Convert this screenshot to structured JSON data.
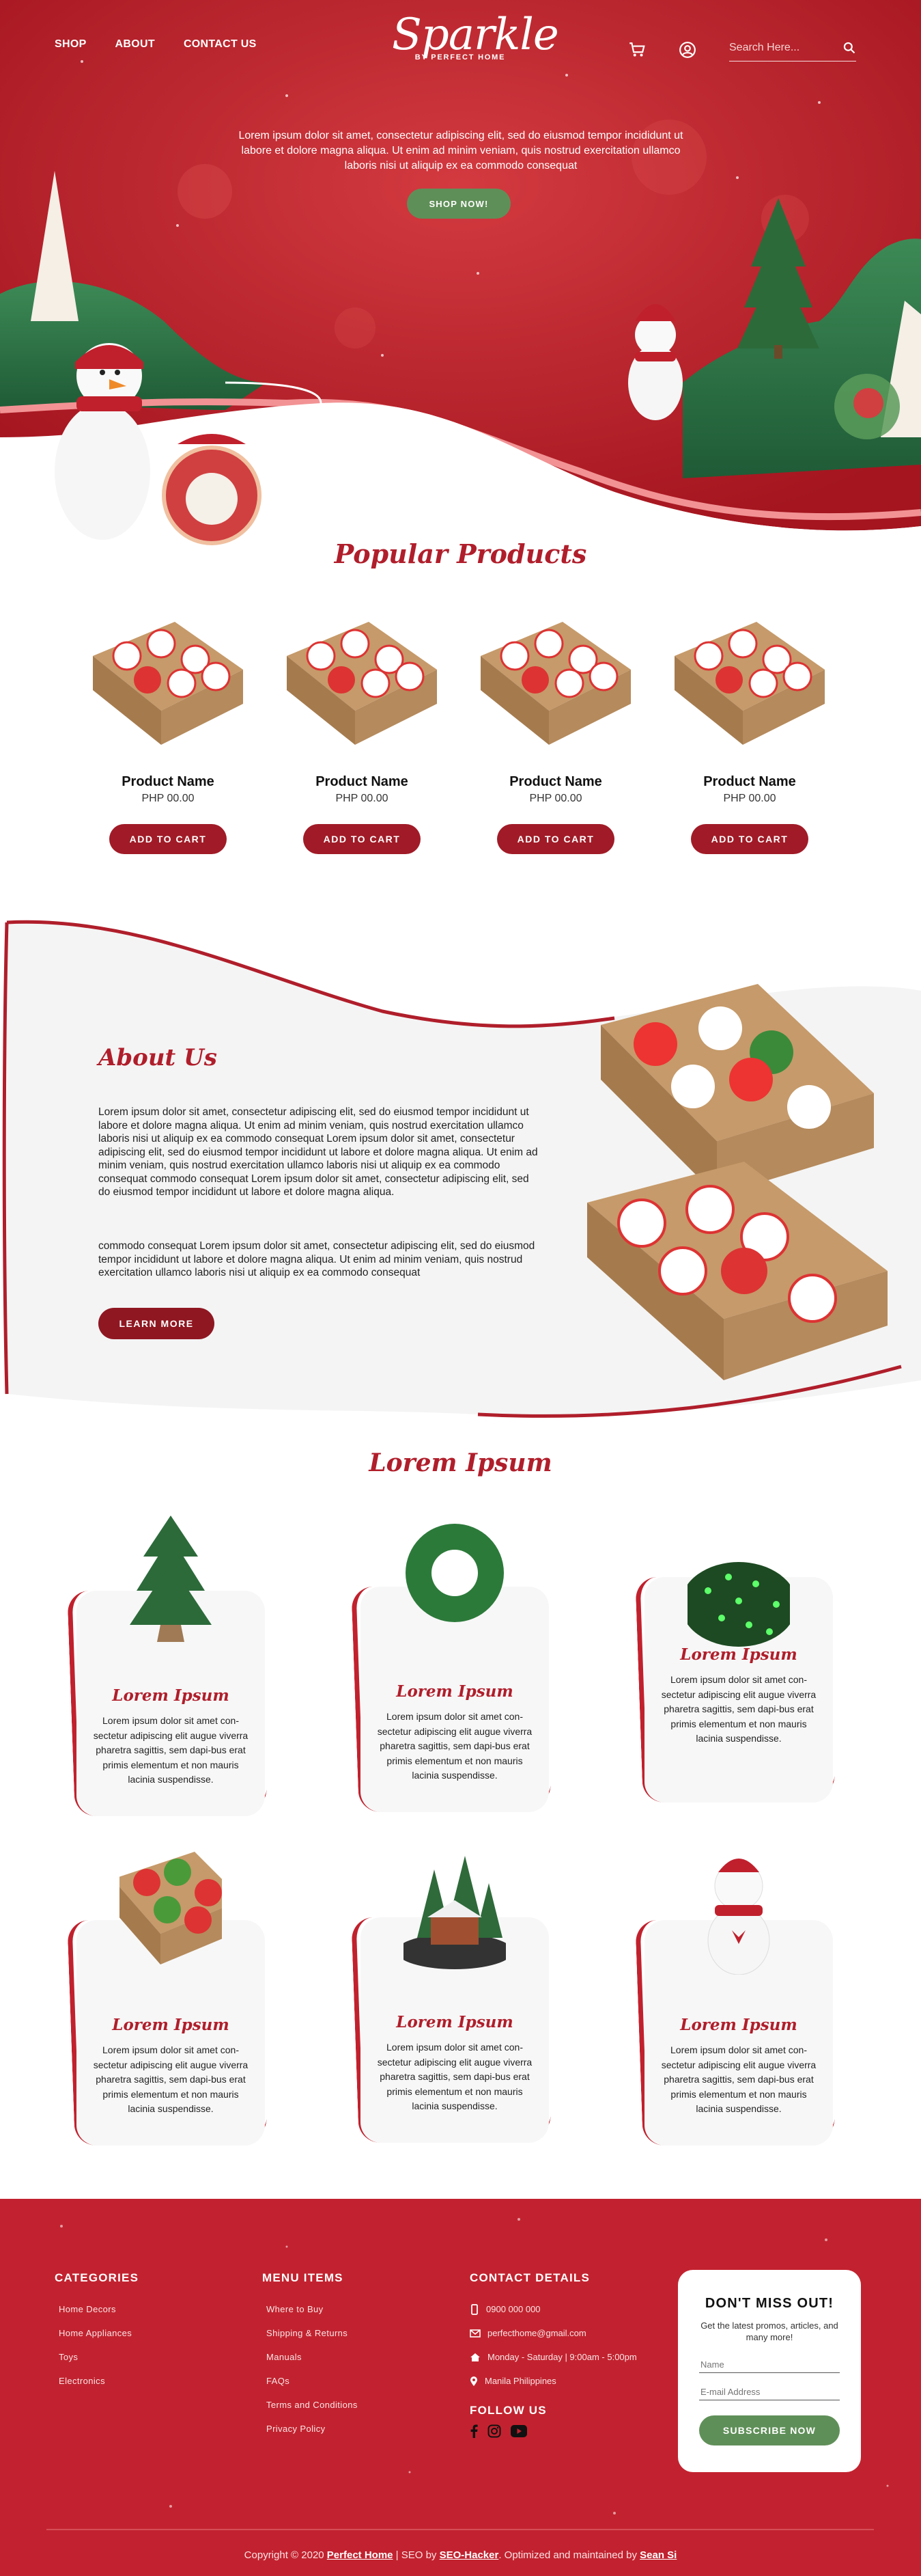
{
  "nav": {
    "shop": "SHOP",
    "about": "ABOUT",
    "contact": "CONTACT US"
  },
  "logo": {
    "main": "Sparkle",
    "sub": "BY PERFECT HOME"
  },
  "search": {
    "placeholder": "Search Here..."
  },
  "hero": {
    "text": "Lorem ipsum dolor sit amet, consectetur adipiscing elit, sed do eiusmod tempor incididunt ut labore et dolore magna aliqua. Ut enim ad minim veniam, quis nostrud exercitation ullamco laboris nisi ut aliquip ex ea commodo consequat",
    "button": "SHOP NOW!"
  },
  "popular": {
    "title": "Popular Products",
    "items": [
      {
        "name": "Product Name",
        "price": "PHP 00.00",
        "button": "ADD TO CART"
      },
      {
        "name": "Product Name",
        "price": "PHP 00.00",
        "button": "ADD TO CART"
      },
      {
        "name": "Product Name",
        "price": "PHP 00.00",
        "button": "ADD TO CART"
      },
      {
        "name": "Product Name",
        "price": "PHP 00.00",
        "button": "ADD TO CART"
      }
    ]
  },
  "about": {
    "title": "About Us",
    "p1": "Lorem ipsum dolor sit amet, consectetur adipiscing elit, sed do eiusmod tempor incididunt ut labore et dolore magna aliqua. Ut enim ad minim veniam, quis nostrud exercitation ullamco laboris nisi ut aliquip ex ea commodo consequat Lorem ipsum dolor sit amet, consectetur adipiscing elit, sed do eiusmod tempor incididunt ut labore et dolore magna aliqua. Ut enim ad minim veniam, quis nostrud exercitation ullamco laboris nisi ut aliquip ex ea commodo consequat commodo consequat Lorem ipsum dolor sit amet, consectetur adipiscing elit, sed do eiusmod tempor incididunt ut labore et dolore magna aliqua.",
    "p2": "commodo consequat Lorem ipsum dolor sit amet, consectetur adipiscing elit, sed do eiusmod tempor incididunt ut labore et dolore magna aliqua. Ut enim ad minim veniam, quis nostrud exercitation ullamco laboris nisi ut aliquip ex ea commodo consequat",
    "button": "LEARN MORE"
  },
  "lorem": {
    "title": "Lorem Ipsum",
    "cards": [
      {
        "title": "Lorem Ipsum",
        "text": "Lorem ipsum dolor sit amet con-sectetur adipiscing elit augue viverra pharetra sagittis, sem dapi-bus erat primis elementum et non mauris lacinia suspendisse.",
        "icon": "christmas-tree"
      },
      {
        "title": "Lorem Ipsum",
        "text": "Lorem ipsum dolor sit amet con-sectetur adipiscing elit augue viverra pharetra sagittis, sem dapi-bus erat primis elementum et non mauris lacinia suspendisse.",
        "icon": "wreath"
      },
      {
        "title": "Lorem Ipsum",
        "text": "Lorem ipsum dolor sit amet con-sectetur adipiscing elit augue viverra pharetra sagittis, sem dapi-bus erat primis elementum et non mauris lacinia suspendisse.",
        "icon": "string-lights"
      },
      {
        "title": "Lorem Ipsum",
        "text": "Lorem ipsum dolor sit amet con-sectetur adipiscing elit augue viverra pharetra sagittis, sem dapi-bus erat primis elementum et non mauris lacinia suspendisse.",
        "icon": "ornament-box"
      },
      {
        "title": "Lorem Ipsum",
        "text": "Lorem ipsum dolor sit amet con-sectetur adipiscing elit augue viverra pharetra sagittis, sem dapi-bus erat primis elementum et non mauris lacinia suspendisse.",
        "icon": "snow-village"
      },
      {
        "title": "Lorem Ipsum",
        "text": "Lorem ipsum dolor sit amet con-sectetur adipiscing elit augue viverra pharetra sagittis, sem dapi-bus erat primis elementum et non mauris lacinia suspendisse.",
        "icon": "snowman"
      }
    ]
  },
  "footer": {
    "categories": {
      "title": "CATEGORIES",
      "items": [
        "Home Decors",
        "Home Appliances",
        "Toys",
        "Electronics"
      ]
    },
    "menu": {
      "title": "MENU ITEMS",
      "items": [
        "Where to Buy",
        "Shipping & Returns",
        "Manuals",
        "FAQs",
        "Terms and Conditions",
        "Privacy Policy"
      ]
    },
    "contact": {
      "title": "CONTACT DETAILS",
      "phone": "0900 000 000",
      "email": "perfecthome@gmail.com",
      "hours": "Monday - Saturday | 9:00am - 5:00pm",
      "address": "Manila Philippines",
      "follow": "FOLLOW US"
    },
    "newsletter": {
      "title": "DON'T MISS OUT!",
      "text": "Get the latest promos, articles, and many more!",
      "name_placeholder": "Name",
      "email_placeholder": "E-mail Address",
      "button": "SUBSCRIBE NOW"
    },
    "copy": {
      "pre": "Copyright © 2020",
      "brand": "Perfect Home",
      "seo_pre": "| SEO by",
      "seo": "SEO-Hacker",
      "mid": ". Optimized and maintained by",
      "author": "Sean Si"
    }
  },
  "colors": {
    "red": "#c2222f",
    "dark_red": "#a01b27",
    "green": "#5f8f58"
  }
}
